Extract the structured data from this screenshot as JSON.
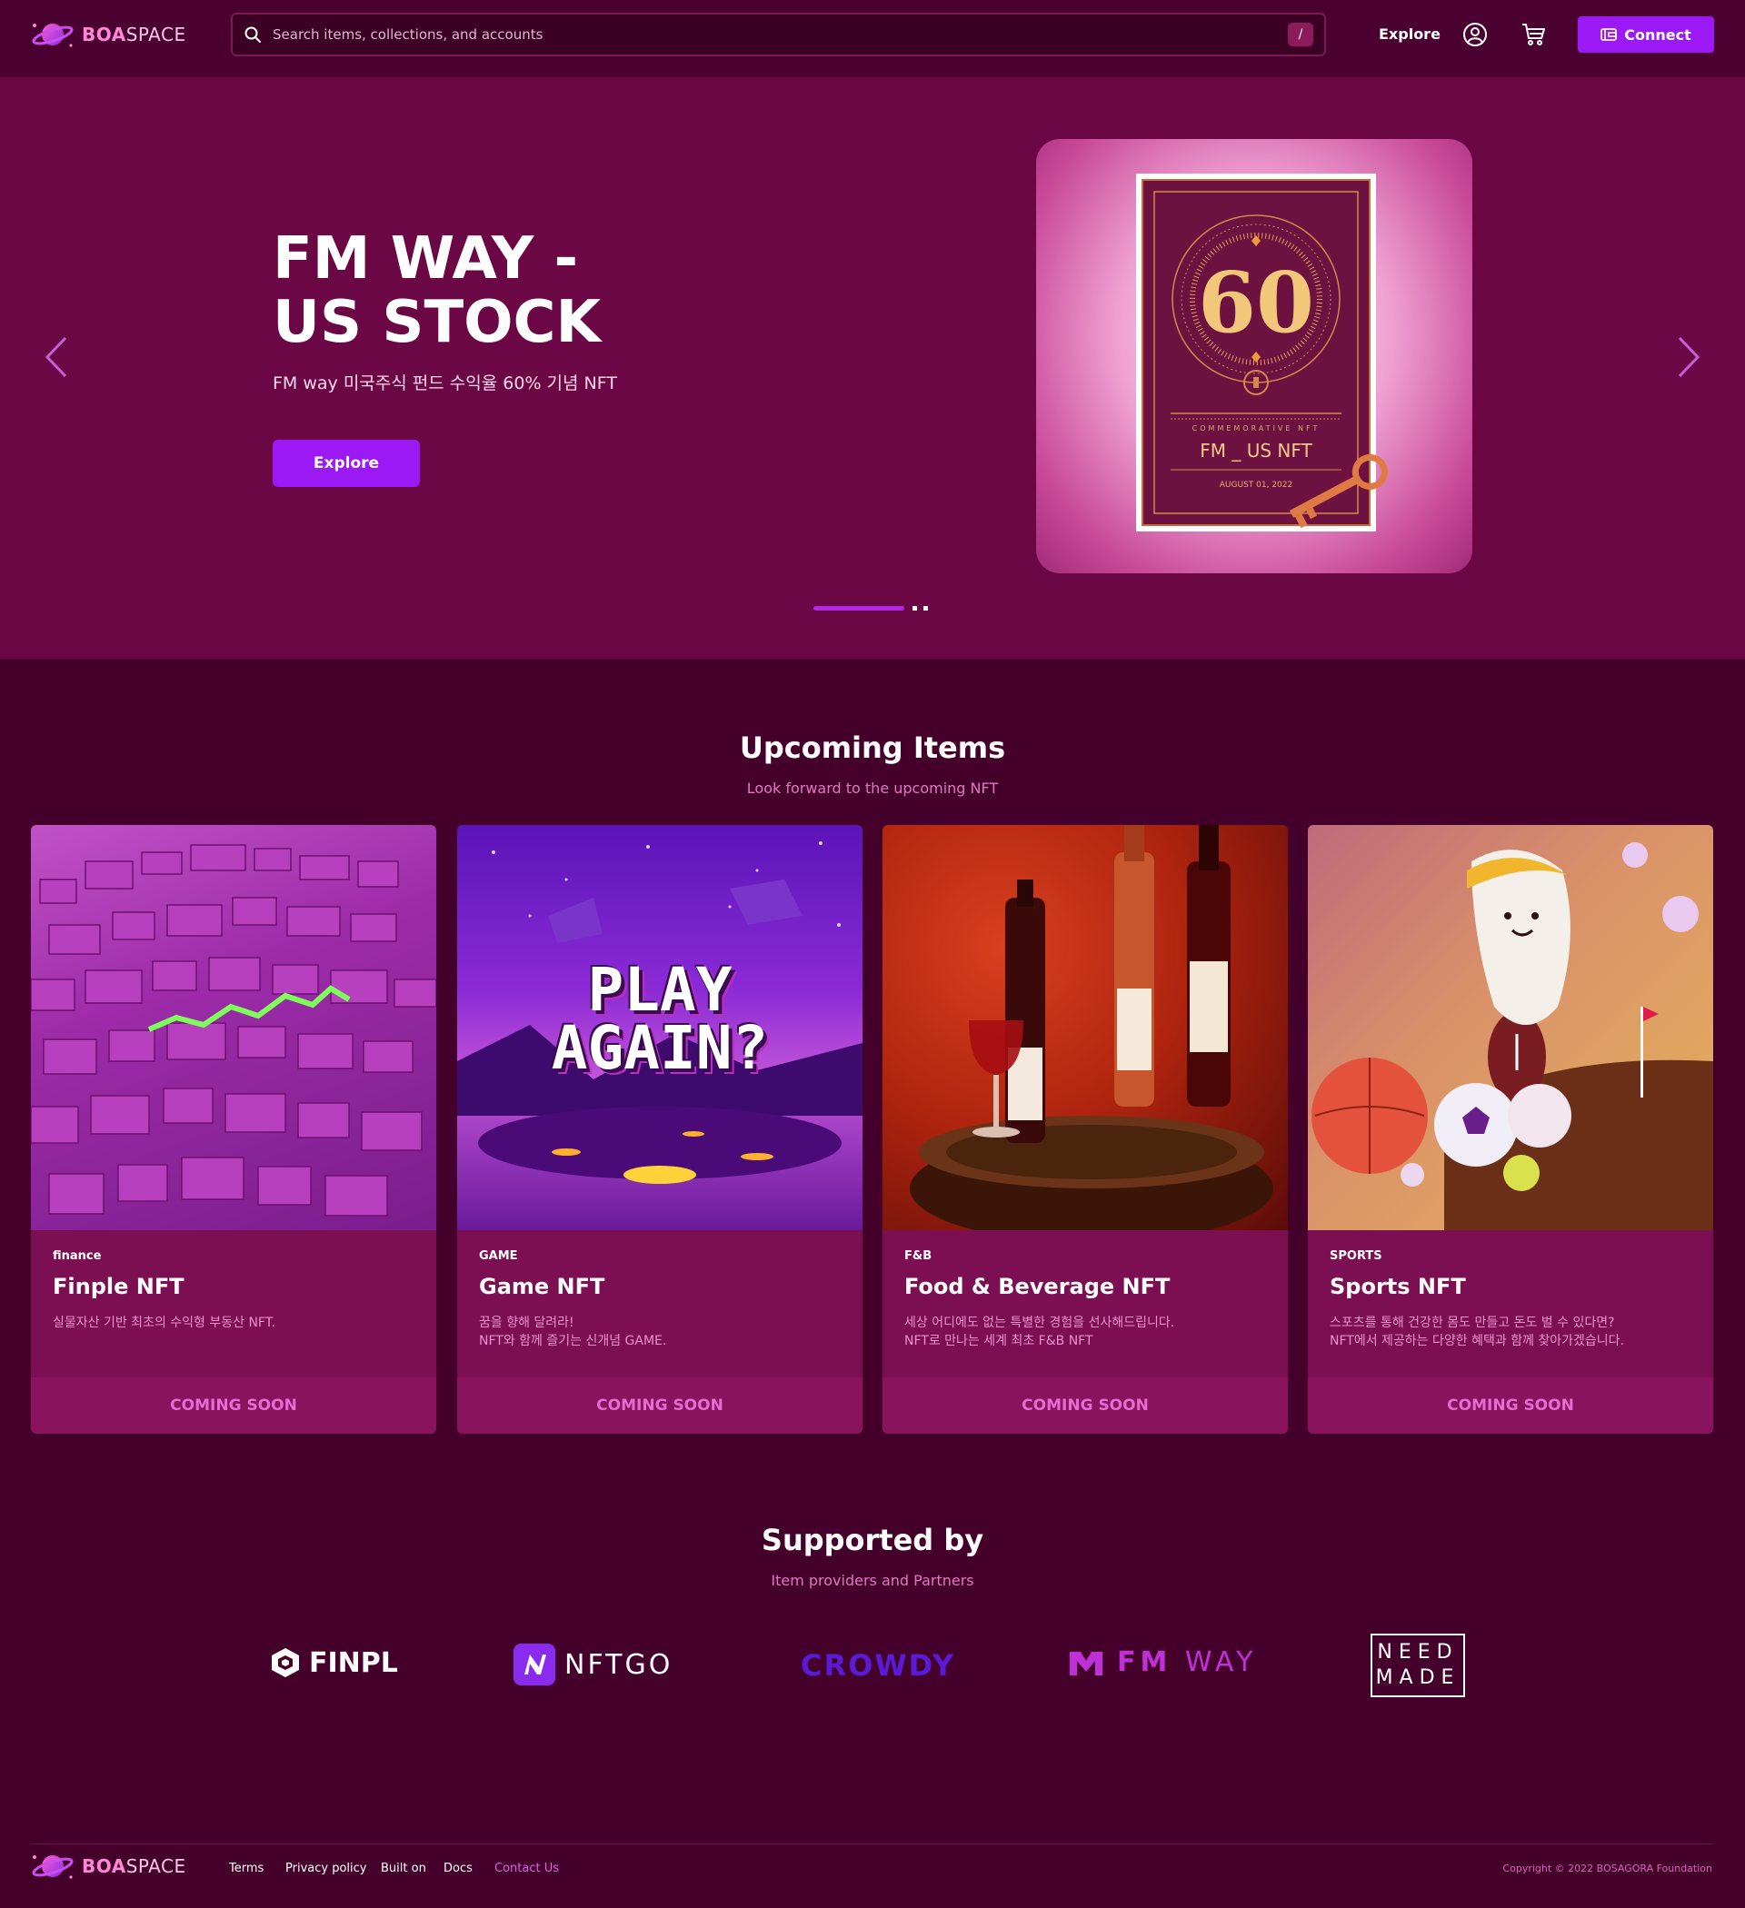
{
  "brand": {
    "bold": "BOA",
    "light": "SPACE"
  },
  "header": {
    "search_placeholder": "Search items, collections, and accounts",
    "search_shortcut": "/",
    "nav_explore": "Explore",
    "connect_label": "Connect",
    "icons": [
      "search-icon",
      "account-icon",
      "cart-icon",
      "wallet-icon"
    ]
  },
  "hero": {
    "title_line1": "FM WAY -",
    "title_line2": "US STOCK",
    "subtitle": "FM way 미국주식 펀드 수익율 60% 기념 NFT",
    "button_label": "Explore",
    "image": {
      "number": "60",
      "commemorative": "COMMEMORATIVE NFT",
      "name": "FM _ US NFT",
      "date": "AUGUST 01, 2022"
    },
    "slides_total": 3,
    "slide_active": 1
  },
  "upcoming": {
    "title": "Upcoming Items",
    "subtitle": "Look forward to the upcoming NFT",
    "cards": [
      {
        "category": "finance",
        "title": "Finple NFT",
        "desc_line1": "실물자산 기반 최초의 수익형 부동산 NFT.",
        "desc_line2": "",
        "button": "COMING SOON"
      },
      {
        "category": "GAME",
        "title": "Game NFT",
        "desc_line1": "꿈을 향해 달려라!",
        "desc_line2": "NFT와 함께 즐기는 신개념 GAME.",
        "button": "COMING SOON",
        "image_text_line1": "PLAY",
        "image_text_line2": "AGAIN?"
      },
      {
        "category": "F&B",
        "title": "Food & Beverage NFT",
        "desc_line1": "세상 어디에도 없는 특별한 경험을 선사해드립니다.",
        "desc_line2": "NFT로 만나는 세계 최초 F&B NFT",
        "button": "COMING SOON"
      },
      {
        "category": "SPORTS",
        "title": "Sports NFT",
        "desc_line1": "스포츠를 통해 건강한 몸도 만들고 돈도 벌 수 있다면?",
        "desc_line2": "NFT에서 제공하는 다양한 혜택과 함께 찾아가겠습니다.",
        "button": "COMING SOON"
      }
    ]
  },
  "supported": {
    "title": "Supported by",
    "subtitle": "Item providers and Partners",
    "partners": {
      "finpl": "FINPL",
      "nftgo": "NFTGO",
      "crowdy": "CROWDY",
      "fmway_bold": "FM",
      "fmway_light": "WAY",
      "needmade_line1": "NEED",
      "needmade_line2": "MADE"
    }
  },
  "footer": {
    "links": [
      "Terms",
      "Privacy policy",
      "Built on",
      "Docs",
      "Contact Us"
    ],
    "copyright": "Copyright © 2022 BOSAGORA Foundation"
  },
  "colors": {
    "accent": "#9b19f5",
    "page_bg": "#44002a",
    "hero_bg": "#6b0744",
    "card_bg": "#7c0f52",
    "coming_soon": "#e86ad4"
  }
}
